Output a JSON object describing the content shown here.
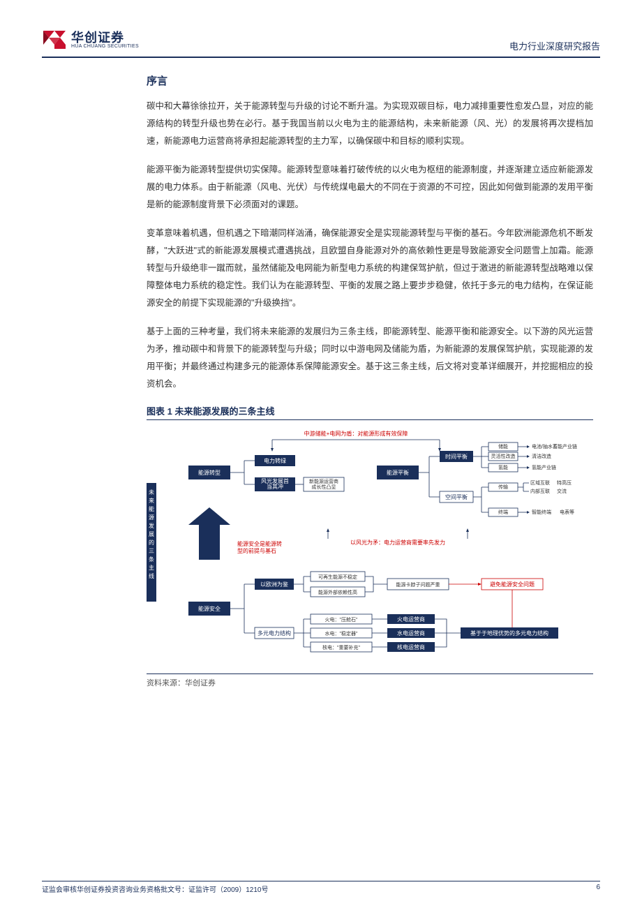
{
  "header": {
    "logo_cn": "华创证券",
    "logo_en": "HUA CHUANG SECURITIES",
    "doc_type": "电力行业深度研究报告"
  },
  "section_title": "序言",
  "paragraphs": [
    "碳中和大幕徐徐拉开，关于能源转型与升级的讨论不断升温。为实现双碳目标，电力减排重要性愈发凸显，对应的能源结构的转型升级也势在必行。基于我国当前以火电为主的能源结构，未来新能源（风、光）的发展将再次提档加速，新能源电力运营商将承担起能源转型的主力军，以确保碳中和目标的顺利实现。",
    "能源平衡为能源转型提供切实保障。能源转型意味着打破传统的以火电为枢纽的能源制度，并逐渐建立适应新能源发展的电力体系。由于新能源（风电、光伏）与传统煤电最大的不同在于资源的不可控，因此如何做到能源的发用平衡是新的能源制度背景下必须面对的课题。",
    "变革意味着机遇，但机遇之下暗潮同样汹涌，确保能源安全是实现能源转型与平衡的基石。今年欧洲能源危机不断发酵，\"大跃进\"式的新能源发展模式遭遇挑战，且欧盟自身能源对外的高依赖性更是导致能源安全问题雪上加霜。能源转型与升级绝非一蹴而就，虽然储能及电网能为新型电力系统的构建保驾护航，但过于激进的新能源转型战略难以保障整体电力系统的稳定性。我们认为在能源转型、平衡的发展之路上要步步稳健，依托于多元的电力结构，在保证能源安全的前提下实现能源的\"升级换挡\"。",
    "基于上面的三种考量，我们将未来能源的发展归为三条主线，即能源转型、能源平衡和能源安全。以下游的风光运营为矛，推动碳中和背景下的能源转型与升级；同时以中游电网及储能为盾，为新能源的发展保驾护航，实现能源的发用平衡；并最终通过构建多元的能源体系保障能源安全。基于这三条主线，后文将对变革详细展开，并挖掘相应的投资机会。"
  ],
  "figure": {
    "title": "图表 1 未来能源发展的三条主线",
    "source": "资料来源：华创证券"
  },
  "diagram": {
    "vertical_label": "未来能源发展的三条主线",
    "caption_top": "中游储能+电网为盾：对能源形成有效保障",
    "caption_mid": "以风光为矛：电力运营商需要率先发力",
    "note_red": "能源安全是能源转型的前提与基石",
    "line1": {
      "root": "能源转型",
      "children": [
        "电力转绿",
        "风光发展首当其冲"
      ],
      "sub": "新能源运营商成长性凸显"
    },
    "line2": {
      "root": "能源平衡",
      "children": [
        "时间平衡",
        "空间平衡"
      ],
      "time_items": [
        "储能",
        "灵活性改造",
        "氢能"
      ],
      "time_chain": [
        "电池/抽水蓄能产业链",
        "清洁改造",
        "氢能产业链"
      ],
      "space_items": [
        "传输",
        "终端"
      ],
      "space_mid": [
        "区域互联",
        "内部互联"
      ],
      "space_right": [
        "特高压",
        "交流"
      ],
      "space_term": [
        "智能终端",
        "电表等"
      ]
    },
    "line3": {
      "root": "能源安全",
      "eu": "以欧洲为鉴",
      "eu_items": [
        "可再生能源不稳定",
        "能源外部依赖性高"
      ],
      "eu_result": "能源卡脖子问题严重",
      "eu_warn": "避免能源安全问题",
      "multi": "多元电力结构",
      "multi_items": [
        "火电：\"压舱石\"",
        "水电：\"稳定器\"",
        "核电：\"重要补充\""
      ],
      "multi_ops": [
        "火电运营商",
        "水电运营商",
        "核电运营商"
      ],
      "multi_conclusion": "基于于地理优势的多元电力结构"
    }
  },
  "footer": {
    "left": "证监会审核华创证券投资咨询业务资格批文号：证监许可（2009）1210号",
    "right": "6"
  }
}
